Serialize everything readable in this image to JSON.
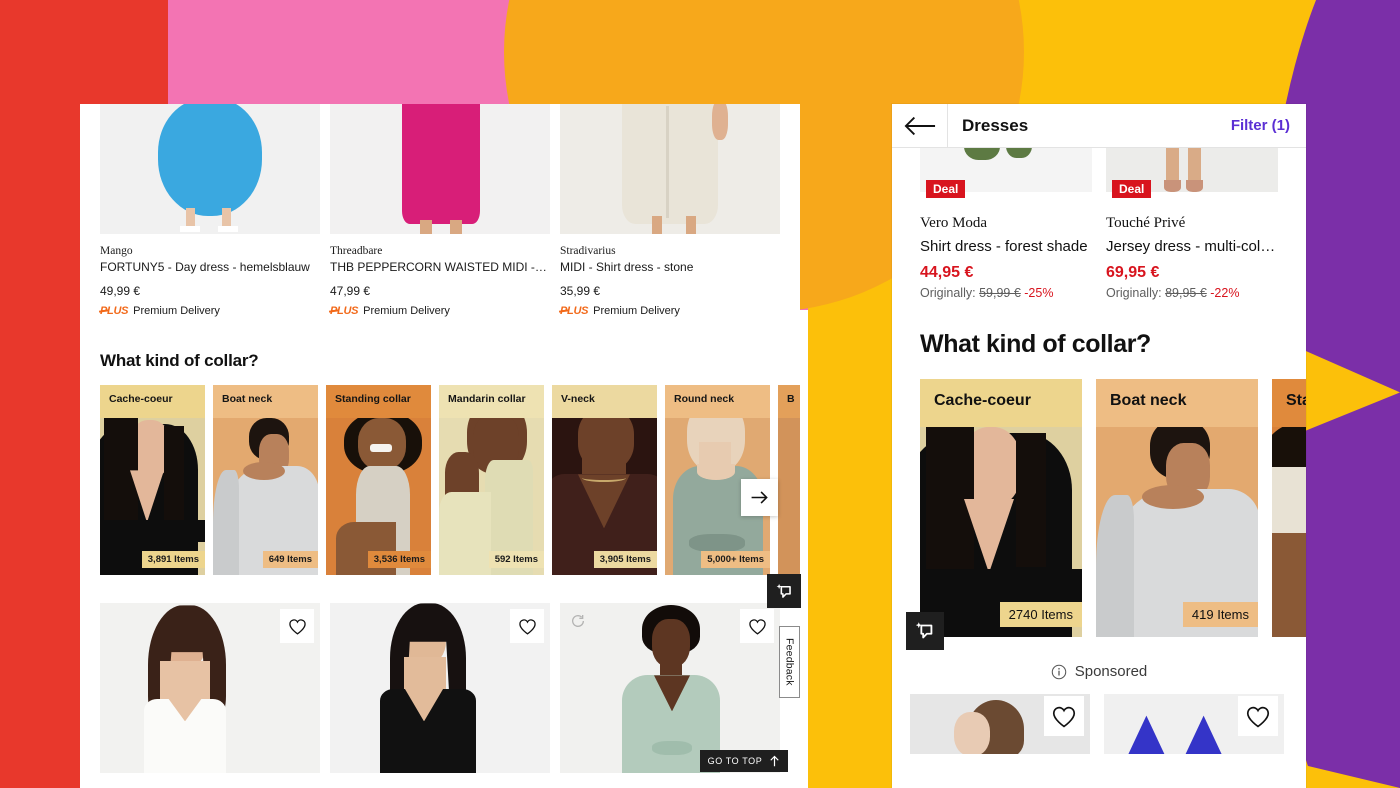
{
  "background": {
    "colors": {
      "red": "#e8382c",
      "pink": "#f374b3",
      "orange": "#f7a81b",
      "yellow": "#fcc00a",
      "purple": "#7b2fa8"
    }
  },
  "desktop": {
    "products_top": [
      {
        "brand": "Mango",
        "name": "FORTUNY5 - Day dress - hemelsblauw",
        "price": "49,99 €",
        "plus_logo": "PLUS",
        "delivery": "Premium Delivery",
        "swatch": "#3aa8e0"
      },
      {
        "brand": "Threadbare",
        "name": "THB PEPPERCORN WAISTED MIDI - Day dr…",
        "price": "47,99 €",
        "plus_logo": "PLUS",
        "delivery": "Premium Delivery",
        "swatch": "#d81e78"
      },
      {
        "brand": "Stradivarius",
        "name": "MIDI - Shirt dress - stone",
        "price": "35,99 €",
        "plus_logo": "PLUS",
        "delivery": "Premium Delivery",
        "swatch": "#e8e3d8"
      }
    ],
    "section_title": "What kind of collar?",
    "collars": [
      {
        "label": "Cache-coeur",
        "items": "3,891 Items",
        "head_bg": "#edd58d",
        "photo_bg": "#ded0a0",
        "badge_bg": "#edd58d"
      },
      {
        "label": "Boat neck",
        "items": "649 Items",
        "head_bg": "#eebd84",
        "photo_bg": "#e3a96f",
        "badge_bg": "#eebd84"
      },
      {
        "label": "Standing collar",
        "items": "3,536 Items",
        "head_bg": "#e08a3c",
        "photo_bg": "#d9813a",
        "badge_bg": "#e08a3c"
      },
      {
        "label": "Mandarin collar",
        "items": "592 Items",
        "head_bg": "#eee2b2",
        "photo_bg": "#e6dcb1",
        "badge_bg": "#eee2b2"
      },
      {
        "label": "V-neck",
        "items": "3,905 Items",
        "head_bg": "#ecd9a0",
        "photo_bg": "#2b1410",
        "badge_bg": "#ecd9a0"
      },
      {
        "label": "Round neck",
        "items": "5,000+ Items",
        "head_bg": "#eebd84",
        "photo_bg": "#e0a972",
        "badge_bg": "#eebd84"
      },
      {
        "label": "B",
        "items": "",
        "head_bg": "#e3a05a",
        "photo_bg": "#d2935a",
        "badge_bg": "#e3a05a"
      }
    ],
    "carousel_next_icon": "arrow-right-icon",
    "products_bottom": [
      {
        "dress": "#f7f7f4",
        "hair": "#3a2218",
        "skin": "#dfb191",
        "has_refresh": false
      },
      {
        "dress": "#111111",
        "hair": "#171110",
        "skin": "#e0b896",
        "has_refresh": false
      },
      {
        "dress": "#b3cbbc",
        "hair": "#120c09",
        "skin": "#5d3622",
        "has_refresh": true
      }
    ],
    "widgets": {
      "ai_badge_icon": "ai-select-icon",
      "feedback_label": "Feedback",
      "go_to_top_label": "GO TO TOP",
      "go_to_top_icon": "arrow-up-icon",
      "heart_icon": "heart-outline-icon",
      "refresh_icon": "refresh-icon"
    }
  },
  "mobile": {
    "header": {
      "back_icon": "arrow-left-icon",
      "title": "Dresses",
      "filter_label": "Filter (1)",
      "filter_color": "#5b2fd4"
    },
    "products_top": [
      {
        "deal_label": "Deal",
        "brand": "Vero Moda",
        "name": "Shirt dress - forest shade",
        "price": "44,95 €",
        "originally_label": "Originally:",
        "original_price": "59,99 €",
        "discount": "-25%"
      },
      {
        "deal_label": "Deal",
        "brand": "Touché Privé",
        "name": "Jersey dress - multi-col…",
        "price": "69,95 €",
        "originally_label": "Originally:",
        "original_price": "89,95 €",
        "discount": "-22%"
      }
    ],
    "section_title": "What kind of collar?",
    "collars": [
      {
        "label": "Cache-coeur",
        "items": "2740 Items",
        "head_bg": "#edd58d",
        "photo_bg": "#ded0a0",
        "badge_bg": "#edd58d"
      },
      {
        "label": "Boat neck",
        "items": "419 Items",
        "head_bg": "#eebd84",
        "photo_bg": "#e3a96f",
        "badge_bg": "#eebd84"
      },
      {
        "label": "Sta",
        "items": "",
        "head_bg": "#e08a3c",
        "photo_bg": "#d9813a",
        "badge_bg": "#e08a3c"
      }
    ],
    "sponsored": {
      "icon": "info-icon",
      "label": "Sponsored"
    },
    "products_bottom": [
      {
        "bg": "#e6e6e6",
        "hair": "#6b4a32",
        "heart_icon": "heart-outline-icon"
      },
      {
        "bg": "#f0f0f0",
        "pattern": "#3434c8",
        "heart_icon": "heart-outline-icon"
      }
    ],
    "ai_badge_icon": "ai-select-icon"
  }
}
